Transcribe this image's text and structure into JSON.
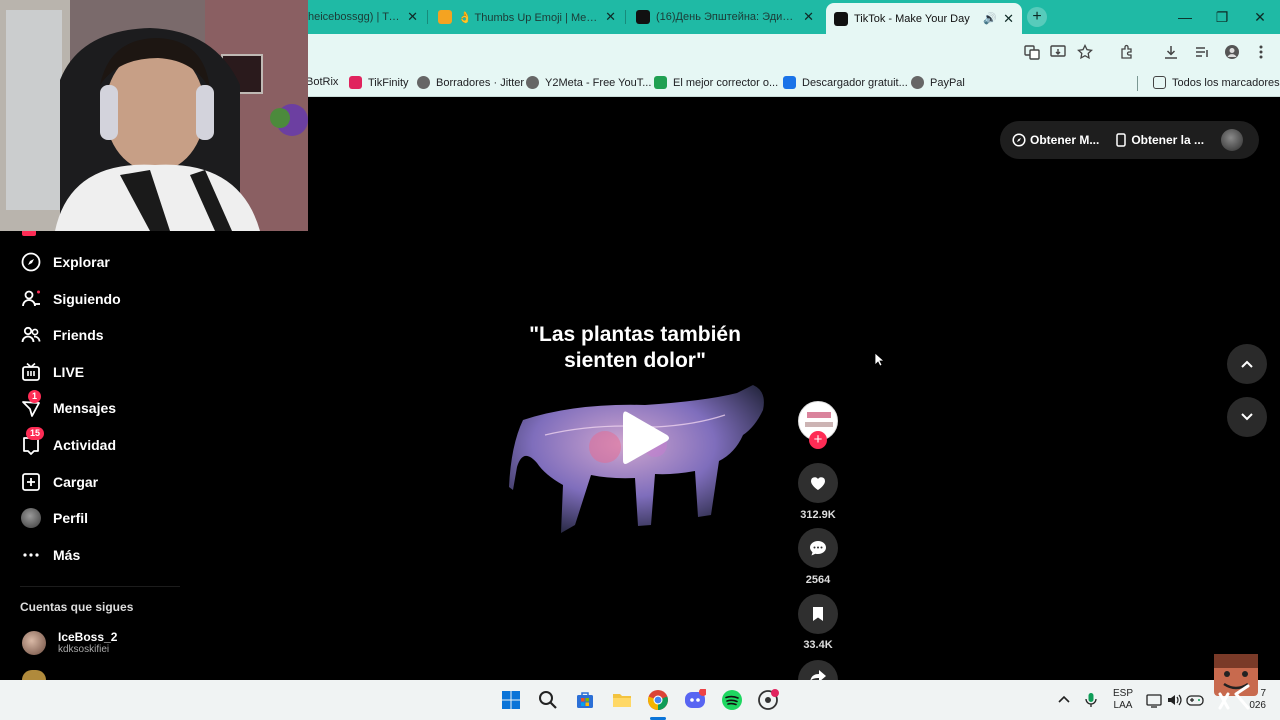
{
  "browser": {
    "tabs": [
      {
        "label": "heicebossgg) | TikT",
        "icon_color": "#8a8a8a"
      },
      {
        "label": "👌 Thumbs Up Emoji | Meaning",
        "icon_color": "#f4a321"
      },
      {
        "label": "(16)День Эпштейна: Эдит и О",
        "icon_color": "#111111"
      },
      {
        "label": "TikTok - Make Your Day",
        "icon_color": "#111111",
        "active": true
      }
    ],
    "window_controls": {
      "minimize": "—",
      "maximize": "❐",
      "close": "✕"
    }
  },
  "bookmarks": [
    {
      "label": "BotRix",
      "icon_color": "#c8c8c8"
    },
    {
      "label": "TikFinity",
      "icon_color": "#e0245e"
    },
    {
      "label": "Borradores · Jitter",
      "icon_color": "#666666"
    },
    {
      "label": "Y2Meta - Free YouT...",
      "icon_color": "#666666"
    },
    {
      "label": "El mejor corrector o...",
      "icon_color": "#20a052"
    },
    {
      "label": "Descargador gratuit...",
      "icon_color": "#1a73e8"
    },
    {
      "label": "PayPal",
      "icon_color": "#666666"
    }
  ],
  "all_bookmarks": "Todos los marcadores",
  "sidebar": {
    "items": [
      {
        "label": "Explorar",
        "icon": "compass-icon"
      },
      {
        "label": "Siguiendo",
        "icon": "user-follow-icon"
      },
      {
        "label": "Friends",
        "icon": "friends-icon"
      },
      {
        "label": "LIVE",
        "icon": "live-tv-icon"
      },
      {
        "label": "Mensajes",
        "icon": "send-icon",
        "badge": "1"
      },
      {
        "label": "Actividad",
        "icon": "inbox-icon",
        "badge": "15"
      },
      {
        "label": "Cargar",
        "icon": "plus-square-icon"
      },
      {
        "label": "Perfil",
        "icon": "avatar"
      },
      {
        "label": "Más",
        "icon": "more-icon"
      }
    ],
    "following_title": "Cuentas que sigues",
    "following": [
      {
        "name": "IceBoss_2",
        "handle": "kdksoskifiei"
      }
    ]
  },
  "top_pill": {
    "get_app": "Obtener M...",
    "get_device": "Obtener la ..."
  },
  "video": {
    "caption_line1": "\"Las plantas también",
    "caption_line2": "sienten dolor\""
  },
  "actions": {
    "likes": "312.9K",
    "comments": "2564",
    "saves": "33.4K"
  },
  "taskbar": {
    "lang_top": "ESP",
    "lang_bottom": "LAA",
    "time_partial": "7",
    "date_partial": "026"
  }
}
